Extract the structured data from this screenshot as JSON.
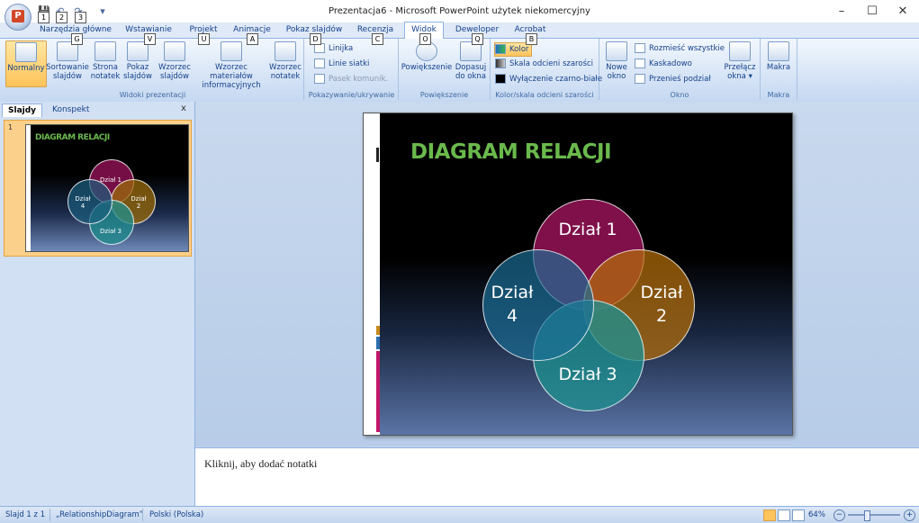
{
  "window": {
    "title": "Prezentacja6 - Microsoft PowerPoint użytek niekomercyjny",
    "minimize": "–",
    "maximize": "☐",
    "close": "✕"
  },
  "qat": {
    "keytips": [
      "1",
      "2",
      "3"
    ]
  },
  "tabs": [
    {
      "label": "Narzędzia główne",
      "keytip": "G"
    },
    {
      "label": "Wstawianie",
      "keytip": "V"
    },
    {
      "label": "Projekt",
      "keytip": "U"
    },
    {
      "label": "Animacje",
      "keytip": "A"
    },
    {
      "label": "Pokaz slajdów",
      "keytip": "D"
    },
    {
      "label": "Recenzja",
      "keytip": "C"
    },
    {
      "label": "Widok",
      "keytip": "O"
    },
    {
      "label": "Deweloper",
      "keytip": "Q"
    },
    {
      "label": "Acrobat",
      "keytip": "B"
    }
  ],
  "ribbon": {
    "widoki": {
      "label": "Widoki prezentacji",
      "buttons": [
        {
          "l1": "Normalny",
          "l2": ""
        },
        {
          "l1": "Sortowanie",
          "l2": "slajdów"
        },
        {
          "l1": "Strona",
          "l2": "notatek"
        },
        {
          "l1": "Pokaz",
          "l2": "slajdów"
        },
        {
          "l1": "Wzorzec",
          "l2": "slajdów"
        },
        {
          "l1": "Wzorzec materiałów",
          "l2": "informacyjnych"
        },
        {
          "l1": "Wzorzec",
          "l2": "notatek"
        }
      ]
    },
    "pokazywanie": {
      "label": "Pokazywanie/ukrywanie",
      "items": [
        "Linijka",
        "Linie siatki",
        "Pasek komunik."
      ]
    },
    "powiekszenie": {
      "label": "Powiększenie",
      "zoom": "Powiększenie",
      "fit_l1": "Dopasuj",
      "fit_l2": "do okna"
    },
    "kolor": {
      "label": "Kolor/skala odcieni szarości",
      "items": [
        "Kolor",
        "Skala odcieni szarości",
        "Wyłączenie czarno-białe"
      ]
    },
    "okno": {
      "label": "Okno",
      "new_l1": "Nowe",
      "new_l2": "okno",
      "items": [
        "Rozmieść wszystkie",
        "Kaskadowo",
        "Przenieś podział"
      ],
      "switch_l1": "Przełącz",
      "switch_l2": "okna ▾"
    },
    "makra": {
      "label": "Makra",
      "button": "Makra"
    }
  },
  "leftpane": {
    "tabs": [
      "Slajdy",
      "Konspekt"
    ],
    "close": "x",
    "slide_number": "1"
  },
  "slide": {
    "title": "DIAGRAM RELACJI",
    "circles": [
      {
        "l1": "Dział",
        "l2": "1",
        "color": "#8a1150"
      },
      {
        "l1": "Dział",
        "l2": "2",
        "color": "#9a6a08"
      },
      {
        "l1": "Dział",
        "l2": "3",
        "color": "#1f8f8f"
      },
      {
        "l1": "Dział",
        "l2": "4",
        "color": "#1b5e7e"
      }
    ]
  },
  "notes": {
    "placeholder": "Kliknij, aby dodać notatki"
  },
  "status": {
    "slide": "Slajd 1 z 1",
    "theme": "„RelationshipDiagram”",
    "language": "Polski (Polska)",
    "zoom": "64%"
  }
}
